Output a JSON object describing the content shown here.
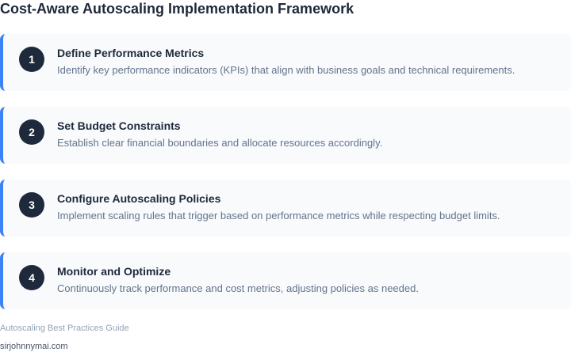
{
  "title": "Cost-Aware Autoscaling Implementation Framework",
  "steps": [
    {
      "number": "1",
      "title": "Define Performance Metrics",
      "description": "Identify key performance indicators (KPIs) that align with business goals and technical requirements."
    },
    {
      "number": "2",
      "title": "Set Budget Constraints",
      "description": "Establish clear financial boundaries and allocate resources accordingly."
    },
    {
      "number": "3",
      "title": "Configure Autoscaling Policies",
      "description": "Implement scaling rules that trigger based on performance metrics while respecting budget limits."
    },
    {
      "number": "4",
      "title": "Monitor and Optimize",
      "description": "Continuously track performance and cost metrics, adjusting policies as needed."
    }
  ],
  "footer": {
    "note": "Autoscaling Best Practices Guide",
    "site": "sirjohnnymai.com"
  },
  "colors": {
    "accent": "#3b82f6",
    "badge": "#1e293b",
    "card_background": "#f8fafc"
  }
}
